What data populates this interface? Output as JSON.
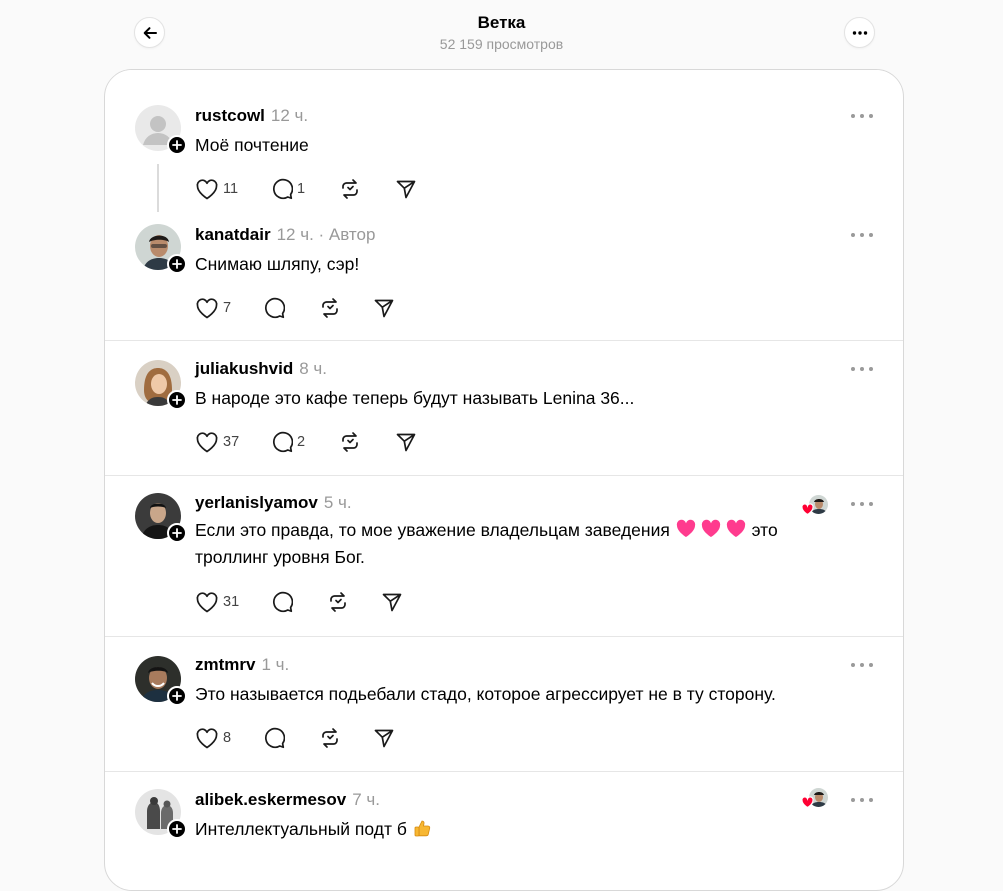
{
  "header": {
    "title": "Ветка",
    "subtitle": "52 159 просмотров"
  },
  "icons": {
    "back": "arrow-left-icon",
    "more": "more-horizontal-icon",
    "like": "heart-outline-icon",
    "reply": "speech-bubble-icon",
    "repost": "repost-icon",
    "share": "send-icon",
    "follow": "plus-icon"
  },
  "colors": {
    "heart": "#ff3b6f",
    "liked_red": "#ff0033"
  },
  "posts": [
    {
      "username": "rustcowl",
      "time": "12 ч.",
      "author_tag": "",
      "text": "Моё почтение",
      "likes": "11",
      "replies": "1"
    },
    {
      "username": "kanatdair",
      "time": "12 ч.",
      "author_tag": "· Автор",
      "text": "Снимаю шляпу, сэр!",
      "likes": "7",
      "replies": ""
    },
    {
      "username": "juliakushvid",
      "time": "8 ч.",
      "author_tag": "",
      "text": "В народе это кафе теперь будут называть Lenina 36...",
      "likes": "37",
      "replies": "2"
    },
    {
      "username": "yerlanislyamov",
      "time": "5 ч.",
      "author_tag": "",
      "text_before": "Если это правда, то мое уважение владельцам заведения",
      "text_after": "это троллинг уровня Бог.",
      "likes": "31",
      "replies": ""
    },
    {
      "username": "zmtmrv",
      "time": "1 ч.",
      "author_tag": "",
      "text": "Это называется подьебали стадо, которое агрессирует не в ту сторону.",
      "likes": "8",
      "replies": ""
    },
    {
      "username": "alibek.eskermesov",
      "time": "7 ч.",
      "author_tag": "",
      "text": "Интеллектуальный подт  б",
      "likes": "",
      "replies": ""
    }
  ]
}
